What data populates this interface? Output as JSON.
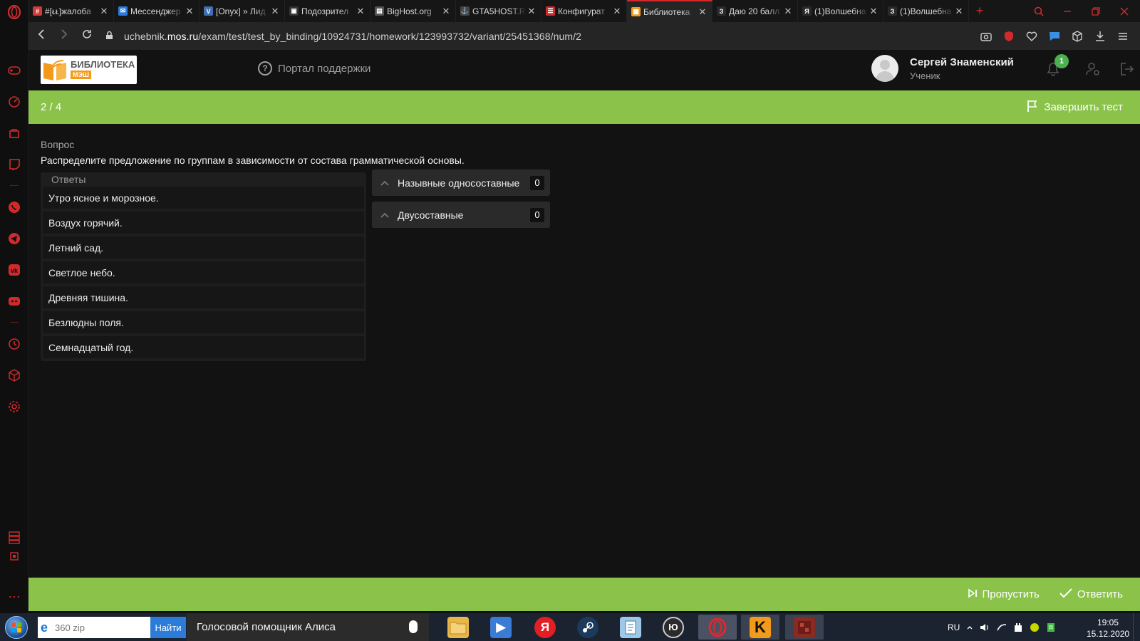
{
  "browser": {
    "tabs": [
      {
        "title": "#[ᴌᴌ]жалоба",
        "favicon_color": "#d23a3a",
        "favicon_glyph": "#"
      },
      {
        "title": "Мессенджер",
        "favicon_color": "#2d7be0",
        "favicon_glyph": "✉"
      },
      {
        "title": "[Onyx] » Лид",
        "favicon_color": "#3f6fb0",
        "favicon_glyph": "V"
      },
      {
        "title": "Подозрител",
        "favicon_color": "#333333",
        "favicon_glyph": "▣"
      },
      {
        "title": "BigHost.org",
        "favicon_color": "#555555",
        "favicon_glyph": "▤"
      },
      {
        "title": "GTA5HOST.R",
        "favicon_color": "#444444",
        "favicon_glyph": "⚓"
      },
      {
        "title": "Конфигурат",
        "favicon_color": "#d22a2a",
        "favicon_glyph": "☰"
      },
      {
        "title": "Библиотека",
        "favicon_color": "#f39a1c",
        "favicon_glyph": "▦",
        "active": true
      },
      {
        "title": "Даю 20 балл",
        "favicon_color": "#2a2a2a",
        "favicon_glyph": "З"
      },
      {
        "title": "(1)Волшебна",
        "favicon_color": "#2a2a2a",
        "favicon_glyph": "Я"
      },
      {
        "title": "(1)Волшебна",
        "favicon_color": "#2a2a2a",
        "favicon_glyph": "З"
      }
    ],
    "url_prefix": "uchebnik.",
    "url_domain": "mos.ru",
    "url_path": "/exam/test/test_by_binding/10924731/homework/123993732/variant/25451368/num/2",
    "accent_color": "#d22a2a"
  },
  "site": {
    "logo_title": "БИБЛИОТЕКА",
    "logo_sub": "МЭШ",
    "support_label": "Портал поддержки",
    "user_name": "Сергей Знаменский",
    "user_role": "Ученик",
    "notification_count": "1"
  },
  "test": {
    "progress": "2 / 4",
    "finish_label": "Завершить тест",
    "question_label": "Вопрос",
    "question_text": "Распределите предложение по группам в зависимости от состава грамматической основы.",
    "answers_header": "Ответы",
    "answers": [
      "Утро ясное и морозное.",
      "Воздух горячий.",
      "Летний сад.",
      "Светлое небо.",
      "Древняя тишина.",
      "Безлюдны поля.",
      "Семнадцатый год."
    ],
    "groups": [
      {
        "label": "Назывные односоставные",
        "count": "0"
      },
      {
        "label": "Двусоставные",
        "count": "0"
      }
    ],
    "skip_label": "Пропустить",
    "answer_label": "Ответить",
    "bar_color": "#8bc34a"
  },
  "taskbar": {
    "search_placeholder": "360 zip",
    "search_button": "Найти",
    "alice_label": "Голосовой помощник Алиса",
    "language": "RU",
    "time": "19:05",
    "date": "15.12.2020"
  }
}
